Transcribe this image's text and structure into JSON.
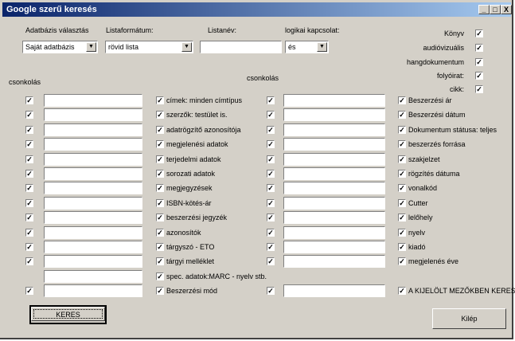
{
  "window": {
    "title": "Google szerű keresés",
    "minimize": "_",
    "maximize": "□",
    "close": "X"
  },
  "header": {
    "db_label": "Adatbázis választás",
    "db_value": "Saját adatbázis",
    "format_label": "Listaformátum:",
    "format_value": "rövid lista",
    "listname_label": "Listanév:",
    "listname_value": "",
    "logic_label": "logikai kapcsolat:",
    "logic_value": "és"
  },
  "doc_types": [
    "Könyv",
    "audióvizuális",
    "hangdokumentum",
    "folyóirat:",
    "cikk:"
  ],
  "section_labels": {
    "left": "csonkolás",
    "right": "csonkolás"
  },
  "left_fields": [
    "címek: minden címtípus",
    "szerzők: testület is.",
    "adatrögzítő azonosítója",
    "megjelenési adatok",
    "terjedelmi adatok",
    "sorozati adatok",
    "megjegyzések",
    "ISBN-kötés-ár",
    "beszerzési jegyzék",
    "azonosítók",
    "tárgyszó - ETO",
    "tárgyi melléklet",
    "spec. adatok:MARC - nyelv stb.",
    "Beszerzési mód"
  ],
  "left_truncate": [
    true,
    true,
    true,
    true,
    true,
    true,
    true,
    true,
    true,
    true,
    true,
    true,
    false,
    true
  ],
  "right_fields": [
    "Beszerzési ár",
    "Beszerzési dátum",
    "Dokumentum státusa: teljes",
    "beszerzés forrása",
    "szakjelzet",
    "rögzítés dátuma",
    "vonalkód",
    "Cutter",
    "lelőhely",
    "nyelv",
    "kiadó",
    "megjelenés éve"
  ],
  "right_truncate_rows": [
    true,
    true,
    true,
    true,
    true,
    true,
    true,
    true,
    true,
    true,
    true,
    true,
    false,
    true
  ],
  "bottom": {
    "search_button": "KERES",
    "exit_button": "Kilép",
    "marked_only": "A KIJELÖLT MEZŐKBEN KERES"
  },
  "checkmark": "✓"
}
